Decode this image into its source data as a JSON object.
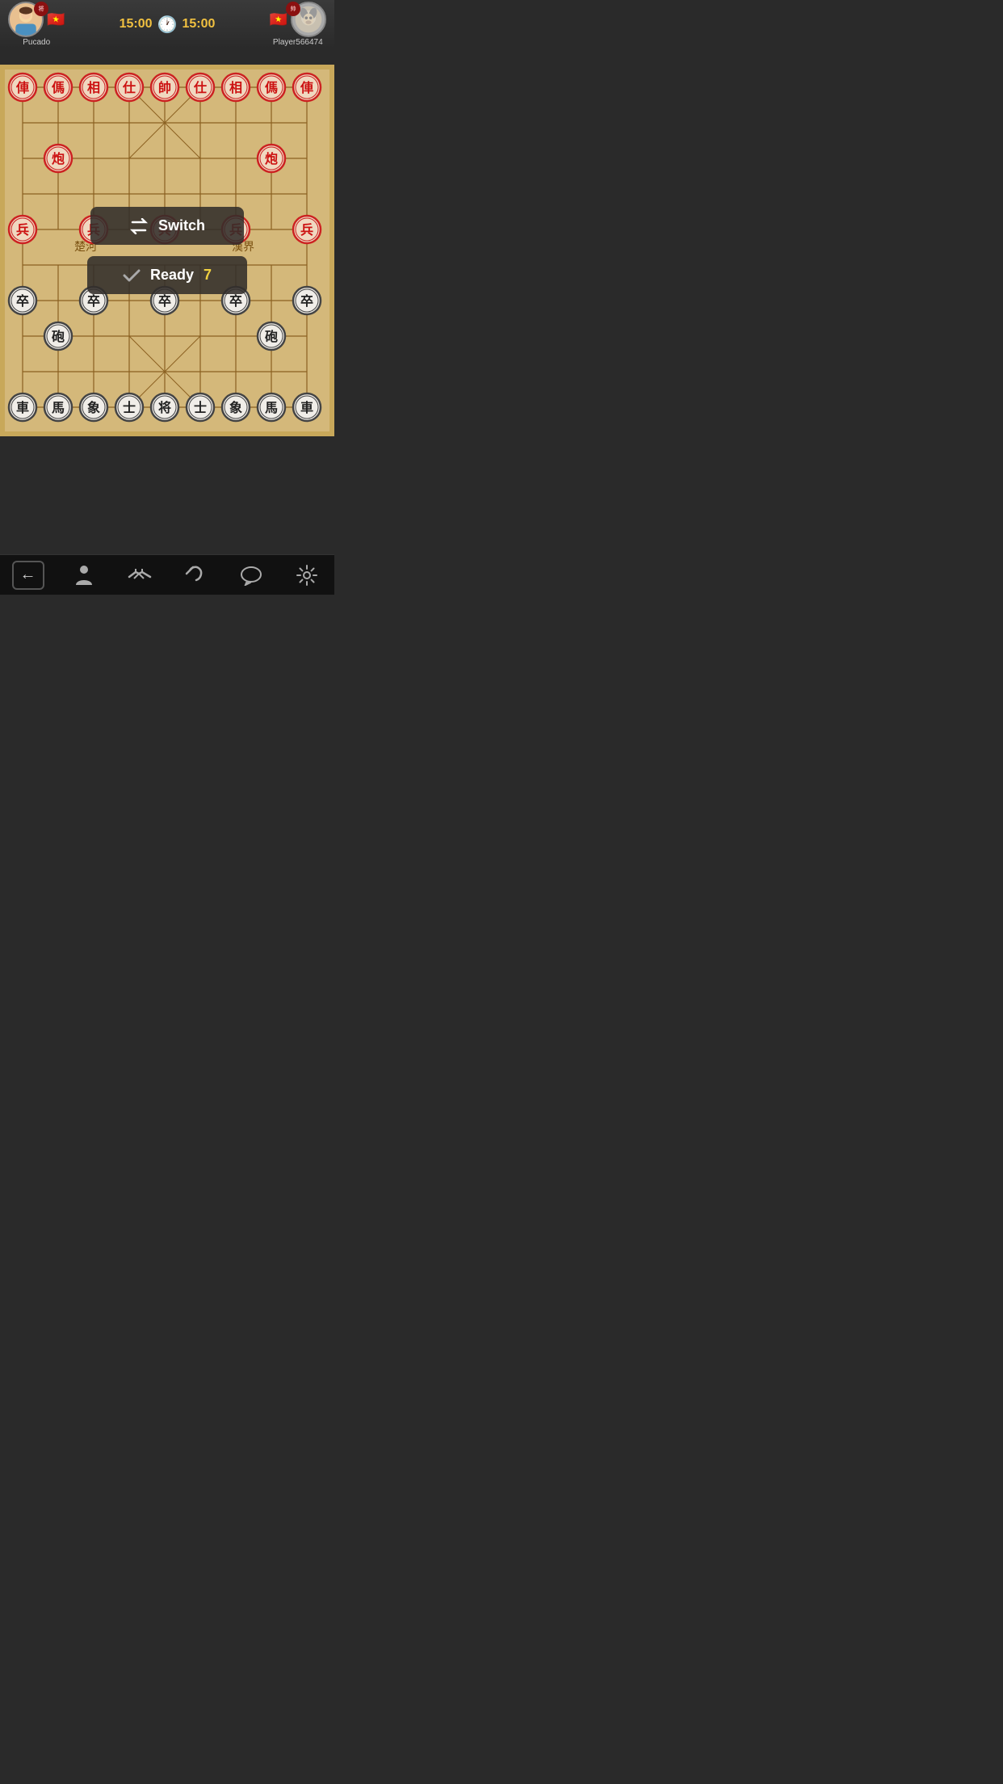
{
  "header": {
    "player1": {
      "name": "Pucado",
      "badge": "将",
      "flag": "🇻🇳",
      "avatar_emoji": "👩"
    },
    "player2": {
      "name": "Player566474",
      "badge": "帅",
      "flag": "🇻🇳",
      "avatar_emoji": "🐏"
    },
    "timer1": "15:00",
    "timer2": "15:00"
  },
  "buttons": {
    "switch_label": "Switch",
    "switch_icon": "⇄",
    "ready_label": "Ready",
    "ready_count": "7",
    "ready_icon": "✓"
  },
  "board": {
    "pieces_red": [
      {
        "char": "俥",
        "col": 0,
        "row": 0
      },
      {
        "char": "傌",
        "col": 1,
        "row": 0
      },
      {
        "char": "相",
        "col": 2,
        "row": 0
      },
      {
        "char": "仕",
        "col": 3,
        "row": 0
      },
      {
        "char": "帥",
        "col": 4,
        "row": 0
      },
      {
        "char": "仕",
        "col": 5,
        "row": 0
      },
      {
        "char": "相",
        "col": 6,
        "row": 0
      },
      {
        "char": "傌",
        "col": 7,
        "row": 0
      },
      {
        "char": "俥",
        "col": 8,
        "row": 0
      },
      {
        "char": "炮",
        "col": 1,
        "row": 2
      },
      {
        "char": "炮",
        "col": 7,
        "row": 2
      },
      {
        "char": "兵",
        "col": 0,
        "row": 4
      },
      {
        "char": "兵",
        "col": 2,
        "row": 4
      },
      {
        "char": "兵",
        "col": 4,
        "row": 4
      },
      {
        "char": "兵",
        "col": 6,
        "row": 4
      },
      {
        "char": "兵",
        "col": 8,
        "row": 4
      }
    ],
    "pieces_black": [
      {
        "char": "卒",
        "col": 0,
        "row": 6
      },
      {
        "char": "卒",
        "col": 2,
        "row": 6
      },
      {
        "char": "卒",
        "col": 4,
        "row": 6
      },
      {
        "char": "卒",
        "col": 6,
        "row": 6
      },
      {
        "char": "卒",
        "col": 8,
        "row": 6
      },
      {
        "char": "砲",
        "col": 1,
        "row": 7
      },
      {
        "char": "砲",
        "col": 7,
        "row": 7
      },
      {
        "char": "車",
        "col": 0,
        "row": 9
      },
      {
        "char": "馬",
        "col": 1,
        "row": 9
      },
      {
        "char": "象",
        "col": 2,
        "row": 9
      },
      {
        "char": "士",
        "col": 3,
        "row": 9
      },
      {
        "char": "将",
        "col": 4,
        "row": 9
      },
      {
        "char": "士",
        "col": 5,
        "row": 9
      },
      {
        "char": "象",
        "col": 6,
        "row": 9
      },
      {
        "char": "馬",
        "col": 7,
        "row": 9
      },
      {
        "char": "車",
        "col": 8,
        "row": 9
      }
    ]
  },
  "toolbar": {
    "back_icon": "←",
    "person_icon": "🚶",
    "handshake_icon": "🤝",
    "undo_icon": "↩",
    "chat_icon": "💬",
    "settings_icon": "⚙"
  }
}
